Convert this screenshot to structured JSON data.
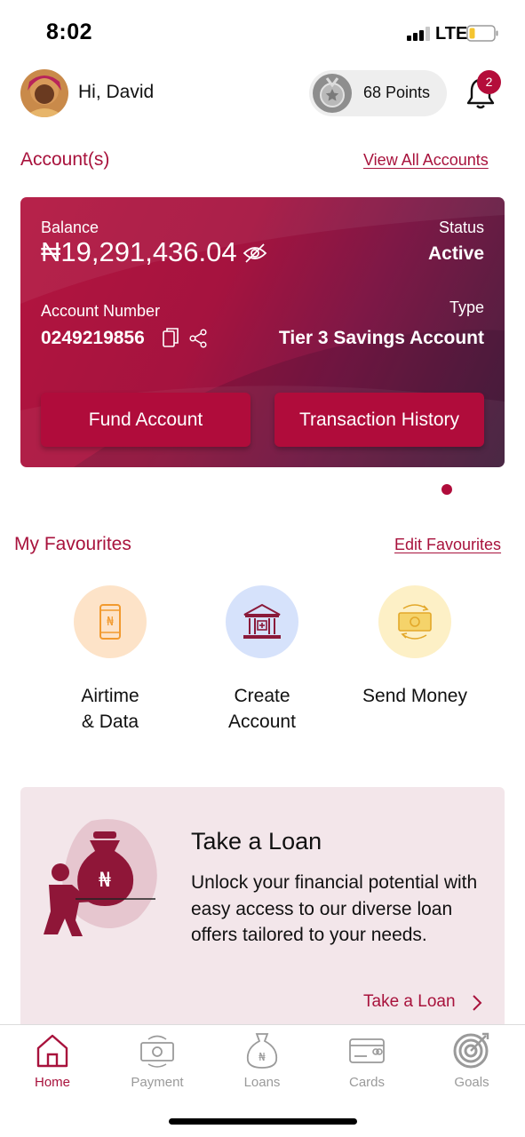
{
  "status_bar": {
    "time": "8:02",
    "network": "LTE"
  },
  "header": {
    "greeting": "Hi, David",
    "points": "68 Points",
    "notification_count": "2"
  },
  "accounts": {
    "title": "Account(s)",
    "view_all": "View All Accounts",
    "card": {
      "balance_label": "Balance",
      "balance": "₦19,291,436.04",
      "status_label": "Status",
      "status": "Active",
      "account_number_label": "Account Number",
      "account_number": "0249219856",
      "type_label": "Type",
      "type": "Tier 3 Savings Account",
      "fund_button": "Fund Account",
      "history_button": "Transaction History"
    }
  },
  "favourites": {
    "title": "My Favourites",
    "edit": "Edit Favourites",
    "items": [
      {
        "line1": "Airtime",
        "line2": "& Data",
        "icon": "phone-naira-icon",
        "color": "#fde3c8"
      },
      {
        "line1": "Create",
        "line2": "Account",
        "icon": "bank-building-icon",
        "color": "#d6e2fb"
      },
      {
        "line1": "Send Money",
        "line2": "",
        "icon": "cash-transfer-icon",
        "color": "#fdf0c6"
      }
    ]
  },
  "loan": {
    "title": "Take a Loan",
    "description": "Unlock your financial potential with easy access to our diverse loan offers tailored to your needs.",
    "link": "Take a Loan"
  },
  "nav": {
    "items": [
      {
        "label": "Home",
        "icon": "home-icon",
        "active": true
      },
      {
        "label": "Payment",
        "icon": "payment-icon",
        "active": false
      },
      {
        "label": "Loans",
        "icon": "loans-bag-icon",
        "active": false
      },
      {
        "label": "Cards",
        "icon": "card-icon",
        "active": false
      },
      {
        "label": "Goals",
        "icon": "target-icon",
        "active": false
      }
    ]
  },
  "colors": {
    "brand": "#a8123c",
    "button": "#b00c3b",
    "loan_bg": "#f3e6ea"
  }
}
